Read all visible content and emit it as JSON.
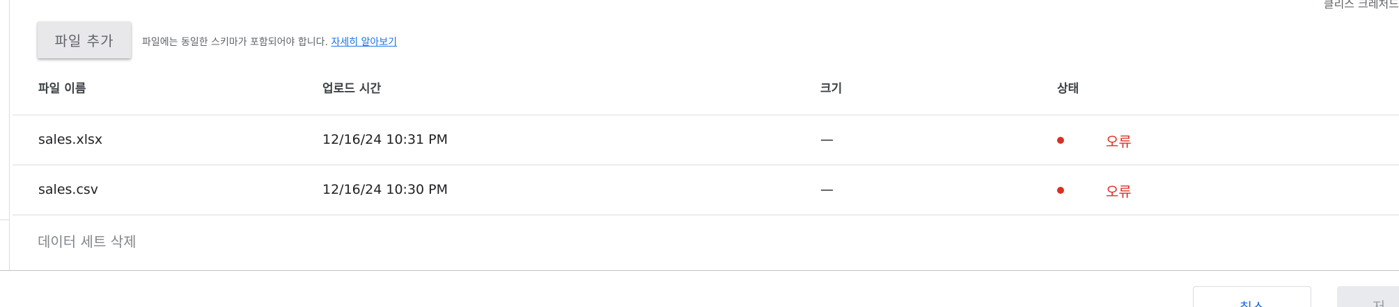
{
  "header": {
    "top_right_partial": "클리스 크레처드"
  },
  "upload": {
    "add_file_label": "파일 추가",
    "hint_text": "파일에는 동일한 스키마가 포함되어야 합니다.",
    "learn_more_label": "자세히 알아보기"
  },
  "table": {
    "columns": {
      "name": "파일 이름",
      "upload_time": "업로드 시간",
      "size": "크기",
      "status": "상태"
    },
    "rows": [
      {
        "name": "sales.xlsx",
        "upload_time": "12/16/24 10:31 PM",
        "size": "—",
        "status": "오류"
      },
      {
        "name": "sales.csv",
        "upload_time": "12/16/24 10:30 PM",
        "size": "—",
        "status": "오류"
      }
    ]
  },
  "actions": {
    "delete_dataset_label": "데이터 세트 삭제",
    "cancel_label": "취소",
    "save_label": "저"
  },
  "colors": {
    "error": "#d93025",
    "link": "#1a73e8"
  }
}
